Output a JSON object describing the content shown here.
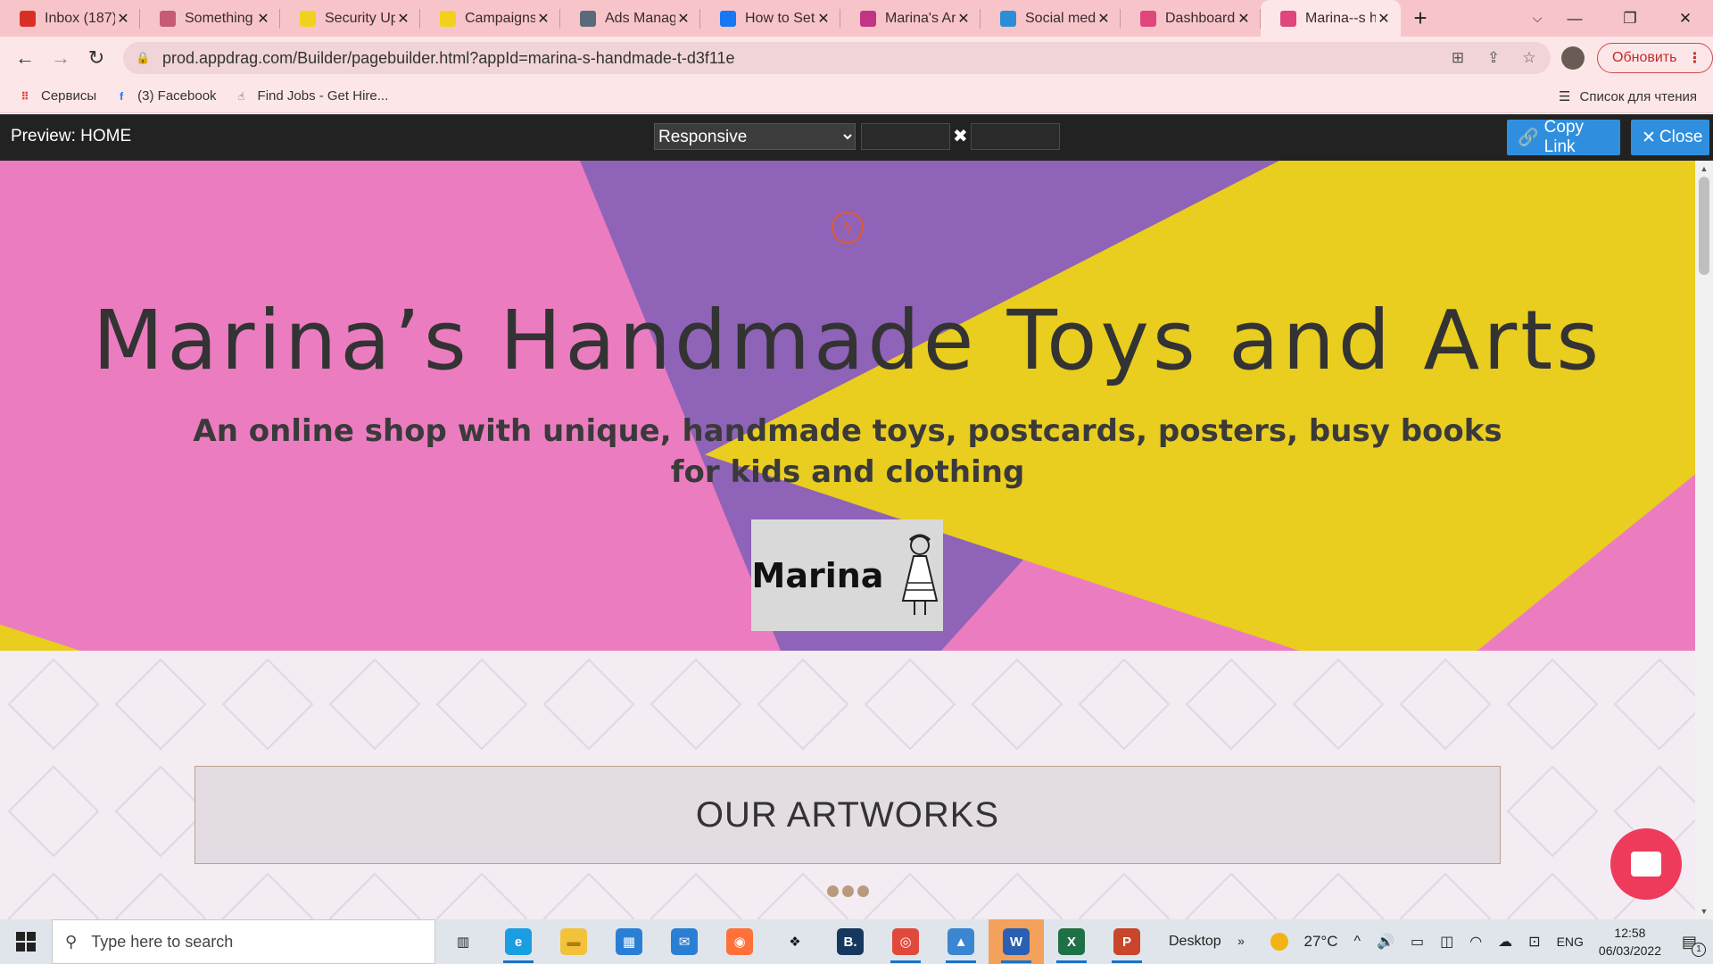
{
  "browser": {
    "tabs": [
      {
        "title": "Inbox (187)",
        "icon": "gmail-icon",
        "color": "#d93025"
      },
      {
        "title": "Something",
        "icon": "document-icon",
        "color": "#c55b74"
      },
      {
        "title": "Security Up",
        "icon": "mailchimp-icon",
        "color": "#f2d11e"
      },
      {
        "title": "Campaigns",
        "icon": "mailchimp-icon",
        "color": "#f2d11e"
      },
      {
        "title": "Ads Manag",
        "icon": "ads-manager-icon",
        "color": "#5a6a7a"
      },
      {
        "title": "How to Set",
        "icon": "meta-icon",
        "color": "#1877f2"
      },
      {
        "title": "Marina's Ar",
        "icon": "instagram-icon",
        "color": "#c13584"
      },
      {
        "title": "Social medi",
        "icon": "canva-icon",
        "color": "#2c8fd6"
      },
      {
        "title": "Dashboard",
        "icon": "appdrag-icon",
        "color": "#e0457b"
      },
      {
        "title": "Marina--s h",
        "icon": "appdrag-icon",
        "color": "#e0457b",
        "active": true
      }
    ],
    "new_tab_symbol": "+",
    "close_symbol": "✕",
    "url": "prod.appdrag.com/Builder/pagebuilder.html?appId=marina-s-handmade-t-d3f11e",
    "update_button": "Обновить",
    "bookmarks": [
      {
        "label": "Сервисы",
        "icon": "apps-grid-icon"
      },
      {
        "label": "(3) Facebook",
        "icon": "facebook-icon"
      },
      {
        "label": "Find Jobs - Get Hire...",
        "icon": "hand-pointer-icon"
      }
    ],
    "reading_list": "Список для чтения"
  },
  "preview_bar": {
    "title": "Preview: HOME",
    "device_select": "Responsive",
    "device_options": [
      "Responsive"
    ],
    "times_symbol": "✖",
    "copy_link": "Copy Link",
    "close": "Close"
  },
  "page": {
    "hero_title": "Marina’s Handmade Toys and Arts",
    "hero_subtitle": "An online shop with unique, handmade toys, postcards, posters, busy books for kids and clothing",
    "brand_text": "Marina",
    "section_title": "OUR ARTWORKS",
    "colors": {
      "pink": "#ec7cc0",
      "purple": "#8f63b8",
      "yellow": "#e9cd1f",
      "chat": "#ef3b5b",
      "accent": "#2f8fde"
    }
  },
  "taskbar": {
    "search_placeholder": "Type here to search",
    "apps": [
      "task-view-icon",
      "edge-icon",
      "file-explorer-icon",
      "store-icon",
      "mail-icon",
      "firefox-icon",
      "dropbox-icon",
      "booking-icon",
      "chrome-icon",
      "photos-icon",
      "word-icon",
      "excel-icon",
      "powerpoint-icon"
    ],
    "desktop_label": "Desktop",
    "chevron": "»",
    "temperature": "27°C",
    "language": "ENG",
    "time": "12:58",
    "date": "06/03/2022",
    "notification_count": "1"
  }
}
